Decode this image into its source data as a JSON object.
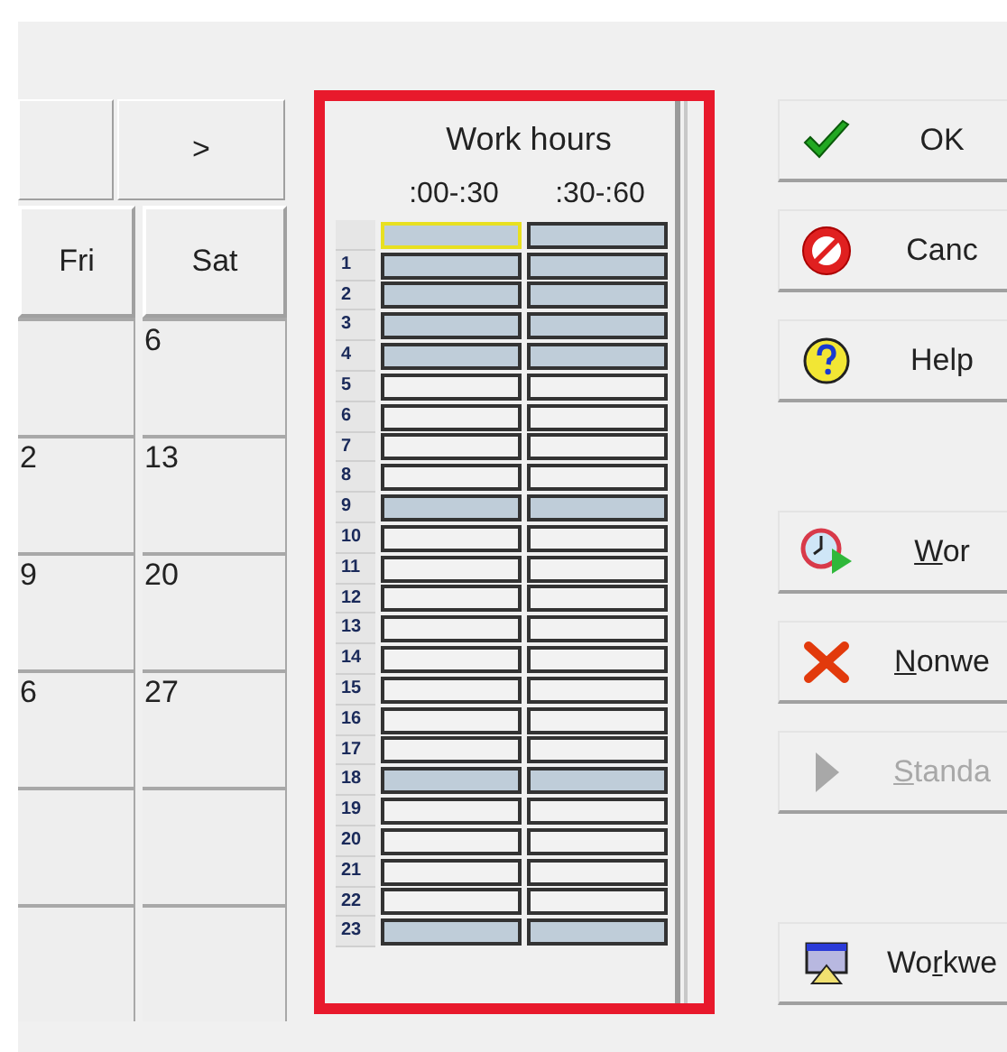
{
  "calendar": {
    "nav": [
      ">"
    ],
    "columns": [
      {
        "header": "Fri",
        "cells": [
          "",
          "2",
          "9",
          "6",
          "",
          ""
        ]
      },
      {
        "header": "Sat",
        "cells": [
          "6",
          "13",
          "20",
          "27",
          "",
          ""
        ]
      }
    ]
  },
  "work_hours": {
    "title": "Work hours",
    "headers": [
      ":00-:30",
      ":30-:60"
    ],
    "rows": [
      {
        "slots": [
          {
            "working": true,
            "focused": true
          },
          {
            "working": true,
            "focused": false
          }
        ]
      },
      {
        "hour": "1",
        "slots": [
          {
            "working": true,
            "focused": false
          },
          {
            "working": true,
            "focused": false
          }
        ]
      },
      {
        "hour": "2",
        "slots": [
          {
            "working": true,
            "focused": false
          },
          {
            "working": true,
            "focused": false
          }
        ]
      },
      {
        "hour": "3",
        "slots": [
          {
            "working": true,
            "focused": false
          },
          {
            "working": true,
            "focused": false
          }
        ]
      },
      {
        "hour": "4",
        "slots": [
          {
            "working": true,
            "focused": false
          },
          {
            "working": true,
            "focused": false
          }
        ]
      },
      {
        "hour": "5",
        "slots": [
          {
            "working": false,
            "focused": false
          },
          {
            "working": false,
            "focused": false
          }
        ]
      },
      {
        "hour": "6",
        "slots": [
          {
            "working": false,
            "focused": false
          },
          {
            "working": false,
            "focused": false
          }
        ]
      },
      {
        "hour": "7",
        "slots": [
          {
            "working": false,
            "focused": false
          },
          {
            "working": false,
            "focused": false
          }
        ]
      },
      {
        "hour": "8",
        "slots": [
          {
            "working": false,
            "focused": false
          },
          {
            "working": false,
            "focused": false
          }
        ]
      },
      {
        "hour": "9",
        "slots": [
          {
            "working": true,
            "focused": false
          },
          {
            "working": true,
            "focused": false
          }
        ]
      },
      {
        "hour": "10",
        "slots": [
          {
            "working": false,
            "focused": false
          },
          {
            "working": false,
            "focused": false
          }
        ]
      },
      {
        "hour": "11",
        "slots": [
          {
            "working": false,
            "focused": false
          },
          {
            "working": false,
            "focused": false
          }
        ]
      },
      {
        "hour": "12",
        "slots": [
          {
            "working": false,
            "focused": false
          },
          {
            "working": false,
            "focused": false
          }
        ]
      },
      {
        "hour": "13",
        "slots": [
          {
            "working": false,
            "focused": false
          },
          {
            "working": false,
            "focused": false
          }
        ]
      },
      {
        "hour": "14",
        "slots": [
          {
            "working": false,
            "focused": false
          },
          {
            "working": false,
            "focused": false
          }
        ]
      },
      {
        "hour": "15",
        "slots": [
          {
            "working": false,
            "focused": false
          },
          {
            "working": false,
            "focused": false
          }
        ]
      },
      {
        "hour": "16",
        "slots": [
          {
            "working": false,
            "focused": false
          },
          {
            "working": false,
            "focused": false
          }
        ]
      },
      {
        "hour": "17",
        "slots": [
          {
            "working": false,
            "focused": false
          },
          {
            "working": false,
            "focused": false
          }
        ]
      },
      {
        "hour": "18",
        "slots": [
          {
            "working": true,
            "focused": false
          },
          {
            "working": true,
            "focused": false
          }
        ]
      },
      {
        "hour": "19",
        "slots": [
          {
            "working": false,
            "focused": false
          },
          {
            "working": false,
            "focused": false
          }
        ]
      },
      {
        "hour": "20",
        "slots": [
          {
            "working": false,
            "focused": false
          },
          {
            "working": false,
            "focused": false
          }
        ]
      },
      {
        "hour": "21",
        "slots": [
          {
            "working": false,
            "focused": false
          },
          {
            "working": false,
            "focused": false
          }
        ]
      },
      {
        "hour": "22",
        "slots": [
          {
            "working": false,
            "focused": false
          },
          {
            "working": false,
            "focused": false
          }
        ]
      },
      {
        "hour": "23",
        "slots": [
          {
            "working": true,
            "focused": false
          },
          {
            "working": true,
            "focused": false
          }
        ]
      }
    ]
  },
  "buttons": [
    {
      "kind": "check",
      "pre": "OK",
      "disabled": false,
      "gap_before": false
    },
    {
      "kind": "noentry",
      "pre": "Canc",
      "disabled": false,
      "gap_before": false
    },
    {
      "kind": "help",
      "pre": "Help",
      "disabled": false,
      "gap_before": false
    },
    {
      "kind": "clock",
      "key": "W",
      "post": "or",
      "disabled": false,
      "gap_before": true
    },
    {
      "kind": "cross",
      "key": "N",
      "post": "onwe",
      "disabled": false,
      "gap_before": false
    },
    {
      "kind": "play",
      "key": "S",
      "post": "tanda",
      "disabled": true,
      "gap_before": false
    },
    {
      "kind": "screen",
      "pre": "Wo",
      "key": "r",
      "post": "kwe",
      "disabled": false,
      "gap_before": true
    }
  ]
}
